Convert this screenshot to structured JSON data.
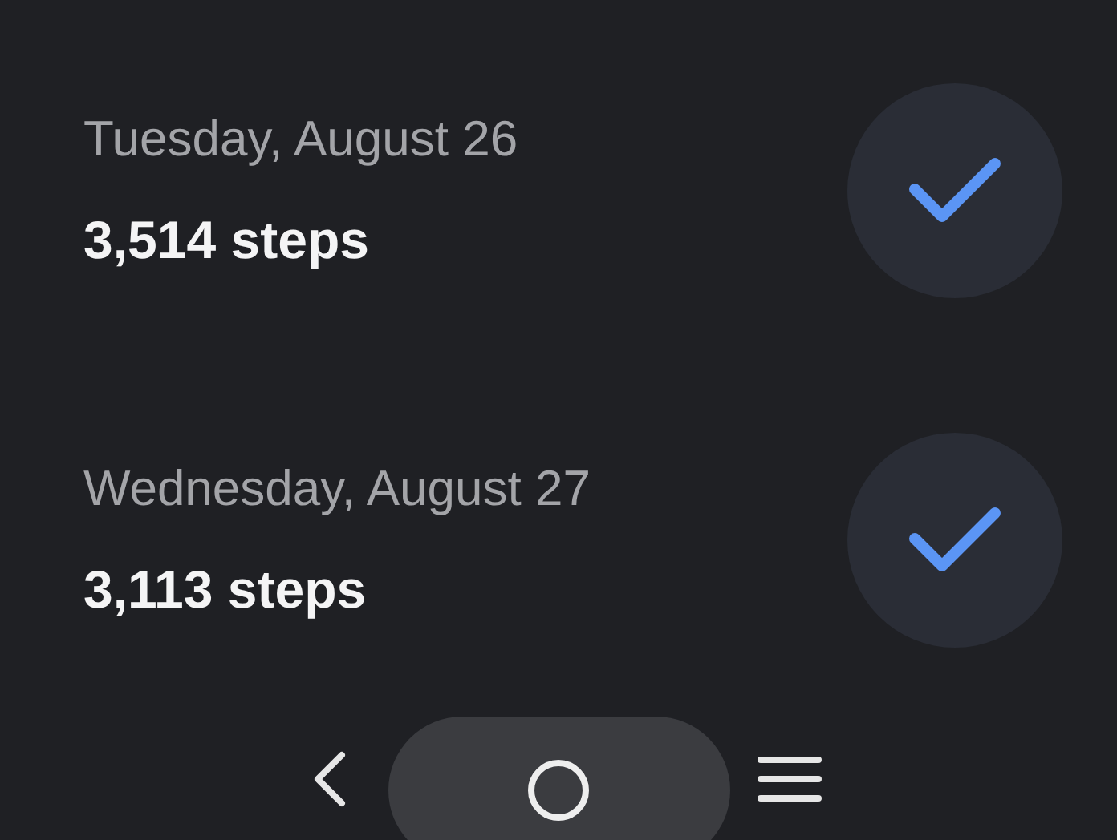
{
  "days": [
    {
      "date": "Tuesday, August 26",
      "steps": "3,514 steps",
      "checked": true
    },
    {
      "date": "Wednesday, August 27",
      "steps": "3,113 steps",
      "checked": true
    }
  ]
}
